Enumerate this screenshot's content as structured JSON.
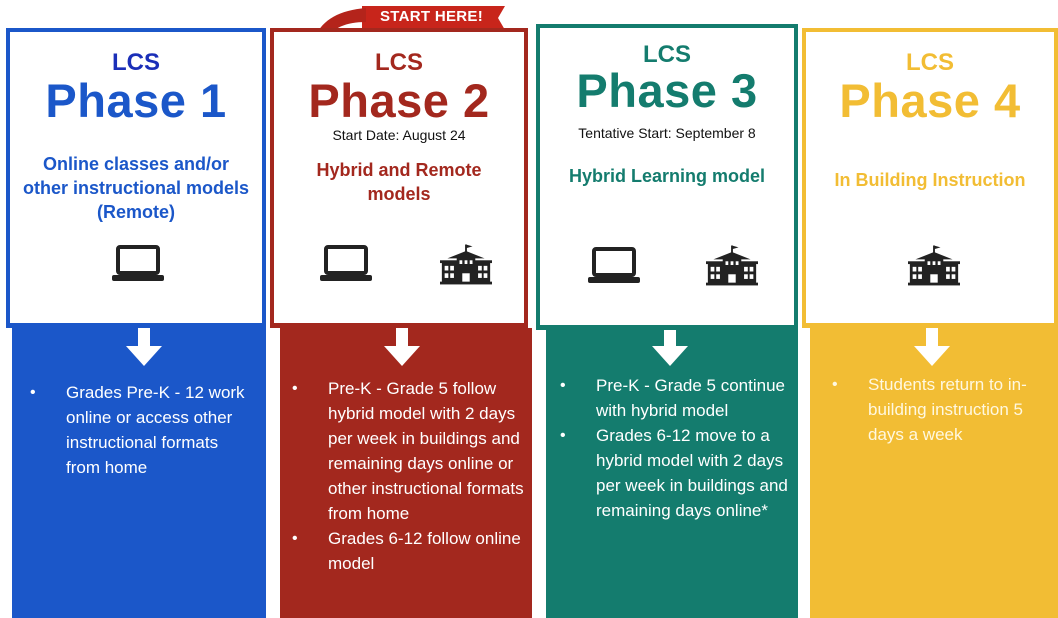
{
  "colors": {
    "phase1": "#1b57c9",
    "phase2": "#a3281e",
    "phase3": "#147c6e",
    "phase4": "#f2bd34",
    "ribbon": "#c8251b"
  },
  "ribbon": {
    "label": "START HERE!"
  },
  "phases": [
    {
      "lcs": "LCS",
      "title": "Phase 1",
      "start": "",
      "description": "Online classes and/or other instructional models (Remote)",
      "icons": [
        "laptop-icon"
      ],
      "bullets": [
        "Grades Pre-K - 12 work online or access other instructional formats from home"
      ]
    },
    {
      "lcs": "LCS",
      "title": "Phase 2",
      "start": "Start Date: August 24",
      "description": "Hybrid and Remote models",
      "icons": [
        "laptop-icon",
        "school-building-icon"
      ],
      "bullets": [
        "Pre-K - Grade 5  follow hybrid model with 2 days per week in buildings and remaining days online or other instructional formats from home",
        "Grades 6-12 follow online model"
      ]
    },
    {
      "lcs": "LCS",
      "title": "Phase 3",
      "start": "Tentative Start: September 8",
      "description": "Hybrid Learning model",
      "icons": [
        "laptop-icon",
        "school-building-icon"
      ],
      "bullets": [
        "Pre-K - Grade 5 continue with hybrid model",
        "Grades 6-12 move to a hybrid model with 2 days per week in buildings and remaining days online*"
      ]
    },
    {
      "lcs": "LCS",
      "title": "Phase 4",
      "start": "",
      "description": "In Building Instruction",
      "icons": [
        "school-building-icon"
      ],
      "bullets": [
        "Students return to in-building instruction 5 days a week"
      ]
    }
  ]
}
